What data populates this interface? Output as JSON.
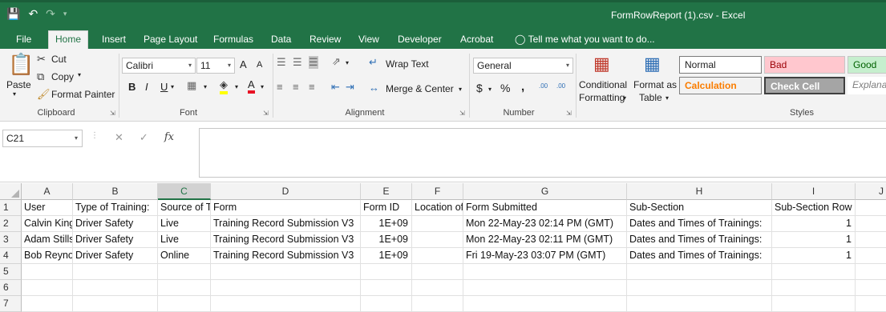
{
  "window": {
    "title": "FormRowReport (1).csv - Excel"
  },
  "tabs": [
    "File",
    "Home",
    "Insert",
    "Page Layout",
    "Formulas",
    "Data",
    "Review",
    "View",
    "Developer",
    "Acrobat"
  ],
  "tell_me": "Tell me what you want to do...",
  "clipboard": {
    "paste": "Paste",
    "cut": "Cut",
    "copy": "Copy",
    "format_painter": "Format Painter",
    "label": "Clipboard"
  },
  "font": {
    "name": "Calibri",
    "size": "11",
    "bold": "B",
    "italic": "I",
    "underline": "U",
    "grow": "A",
    "shrink": "A",
    "label": "Font"
  },
  "alignment": {
    "wrap": "Wrap Text",
    "merge": "Merge & Center",
    "label": "Alignment"
  },
  "number": {
    "format": "General",
    "currency": "$",
    "percent": "%",
    "comma": ",",
    "inc_dec": ".00",
    "dec_dec": ".00",
    "label": "Number"
  },
  "styles": {
    "conditional": "Conditional Formatting",
    "conditional_line1": "Conditional",
    "conditional_line2": "Formatting",
    "format_table_line1": "Format as",
    "format_table_line2": "Table",
    "normal": "Normal",
    "bad": "Bad",
    "good": "Good",
    "calculation": "Calculation",
    "check_cell": "Check Cell",
    "explanatory": "Explanat",
    "label": "Styles",
    "colors": {
      "bad_bg": "#ffc7ce",
      "bad_fg": "#9c0006",
      "good_bg": "#c6efce",
      "good_fg": "#006100",
      "calc_fg": "#fa7d00",
      "check_bg": "#a5a5a5"
    }
  },
  "formula_bar": {
    "name_box": "C21",
    "cancel": "✕",
    "enter": "✓",
    "fx": "fx",
    "formula": ""
  },
  "sheet": {
    "columns": [
      "A",
      "B",
      "C",
      "D",
      "E",
      "F",
      "G",
      "H",
      "I",
      "J"
    ],
    "selected_column": "C",
    "row_numbers": [
      "1",
      "2",
      "3",
      "4",
      "5",
      "6",
      "7"
    ],
    "rows": [
      [
        "User",
        "Type of Training:",
        "Source of Training:",
        "Form",
        "Form ID",
        "Location of",
        "Form Submitted",
        "Sub-Section",
        "Sub-Section Row",
        ""
      ],
      [
        "Calvin King",
        "Driver Safety",
        "Live",
        "Training Record Submission V3",
        "1E+09",
        "",
        "Mon 22-May-23 02:14 PM (GMT)",
        "Dates and Times of Trainings:",
        "1",
        ""
      ],
      [
        "Adam Stills",
        "Driver Safety",
        "Live",
        "Training Record Submission V3",
        "1E+09",
        "",
        "Mon 22-May-23 02:11 PM (GMT)",
        "Dates and Times of Trainings:",
        "1",
        ""
      ],
      [
        "Bob Reynolds",
        "Driver Safety",
        "Online",
        "Training Record Submission V3",
        "1E+09",
        "",
        "Fri 19-May-23 03:07 PM (GMT)",
        "Dates and Times of Trainings:",
        "1",
        ""
      ],
      [
        "",
        "",
        "",
        "",
        "",
        "",
        "",
        "",
        "",
        ""
      ],
      [
        "",
        "",
        "",
        "",
        "",
        "",
        "",
        "",
        "",
        ""
      ],
      [
        "",
        "",
        "",
        "",
        "",
        "",
        "",
        "",
        "",
        ""
      ]
    ]
  },
  "colors": {
    "excel_green": "#217346",
    "ribbon_bg": "#f3f3f3"
  }
}
